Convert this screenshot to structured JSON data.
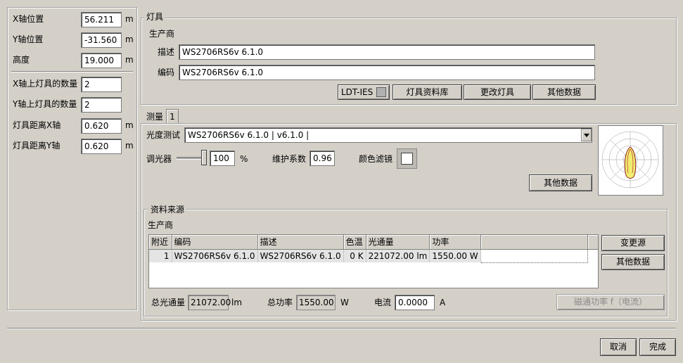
{
  "left_panel": {
    "rows": [
      {
        "label": "X轴位置",
        "value": "56.211",
        "unit": "m"
      },
      {
        "label": "Y轴位置",
        "value": "-31.560",
        "unit": "m"
      },
      {
        "label": "高度",
        "value": "19.000",
        "unit": "m"
      }
    ],
    "rows2": [
      {
        "label": "X轴上灯具的数量",
        "value": "2",
        "unit": ""
      },
      {
        "label": "Y轴上灯具的数量",
        "value": "2",
        "unit": ""
      },
      {
        "label": "灯具距离X轴",
        "value": "0.620",
        "unit": "m"
      },
      {
        "label": "灯具距离Y轴",
        "value": "0.620",
        "unit": "m"
      }
    ]
  },
  "luminaire": {
    "group_title": "灯具",
    "manufacturer_label": "生产商",
    "description_label": "描述",
    "description_value": "WS2706RS6v 6.1.0",
    "code_label": "编码",
    "code_value": "WS2706RS6v 6.1.0",
    "buttons": {
      "ldt_ies": "LDT-IES",
      "database": "灯具资料库",
      "change": "更改灯具",
      "other": "其他数据"
    }
  },
  "measurement": {
    "tabs": [
      "测量",
      "1"
    ],
    "photometry_label": "光度测试",
    "photometry_value": "WS2706RS6v 6.1.0 | v6.1.0 |",
    "dimmer_label": "调光器",
    "dimmer_value": "100",
    "dimmer_unit": "%",
    "dimmer_level": 1.0,
    "maintenance_label": "维护系数",
    "maintenance_value": "0.96",
    "color_filter_label": "颜色滤镜",
    "other_button": "其他数据"
  },
  "source": {
    "group_title": "资料来源",
    "manufacturer_label": "生产商",
    "columns": [
      "附近",
      "编码",
      "描述",
      "色温",
      "光通量",
      "功率"
    ],
    "rows": [
      {
        "near": "1",
        "code": "WS2706RS6v 6.1.0",
        "desc": "WS2706RS6v 6.1.0",
        "cct": "0 K",
        "flux": "221072.00 lm",
        "power": "1550.00 W"
      }
    ],
    "change_source_button": "变更源",
    "other_button": "其他数据",
    "total_flux_label": "总光通量",
    "total_flux_value": "21072.00",
    "total_flux_unit": "lm",
    "total_power_label": "总功率",
    "total_power_value": "1550.00",
    "total_power_unit": "W",
    "current_label": "电流",
    "current_value": "0.0000",
    "current_unit": "A",
    "flux_power_button": "磁通功率  f（电流）"
  },
  "footer": {
    "cancel": "取消",
    "finish": "完成"
  }
}
